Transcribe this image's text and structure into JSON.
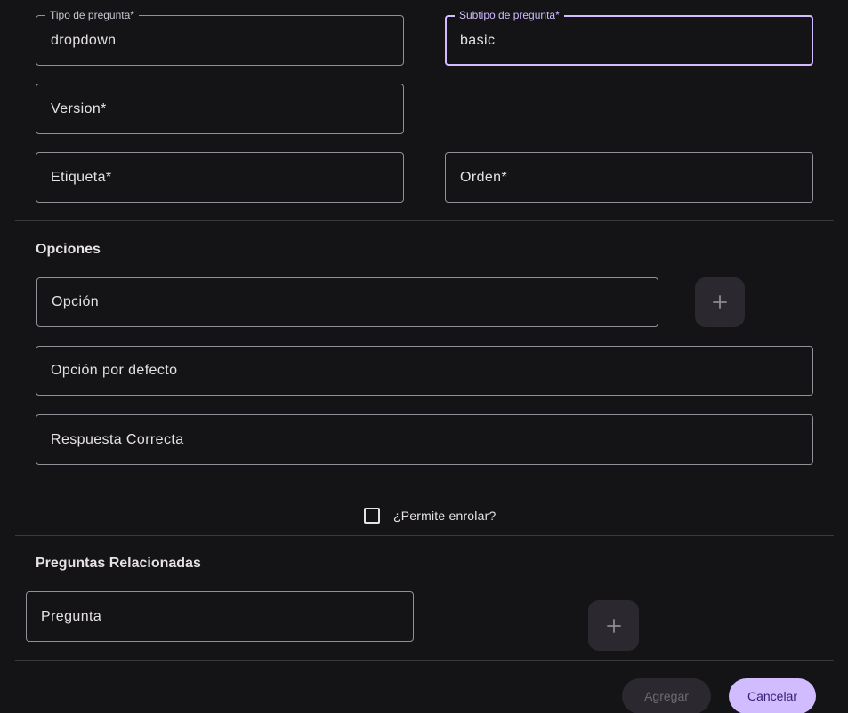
{
  "form": {
    "question_type": {
      "label": "Tipo de pregunta*",
      "value": "dropdown"
    },
    "question_subtype": {
      "label": "Subtipo de pregunta*",
      "value": "basic"
    },
    "version": {
      "placeholder": "Version*"
    },
    "label": {
      "placeholder": "Etiqueta*"
    },
    "order": {
      "placeholder": "Orden*"
    }
  },
  "options_section": {
    "title": "Opciones",
    "option": {
      "placeholder": "Opción"
    },
    "default_option": {
      "placeholder": "Opción por defecto"
    },
    "correct_answer": {
      "placeholder": "Respuesta Correcta"
    },
    "add_icon": "plus-icon"
  },
  "enroll": {
    "label": "¿Permite enrolar?",
    "checked": false
  },
  "related_section": {
    "title": "Preguntas Relacionadas",
    "question": {
      "placeholder": "Pregunta"
    },
    "add_icon": "plus-icon"
  },
  "actions": {
    "add_label": "Agregar",
    "cancel_label": "Cancelar"
  },
  "colors": {
    "background": "#141316",
    "accent": "#d0bcff",
    "outline": "#938f99"
  }
}
